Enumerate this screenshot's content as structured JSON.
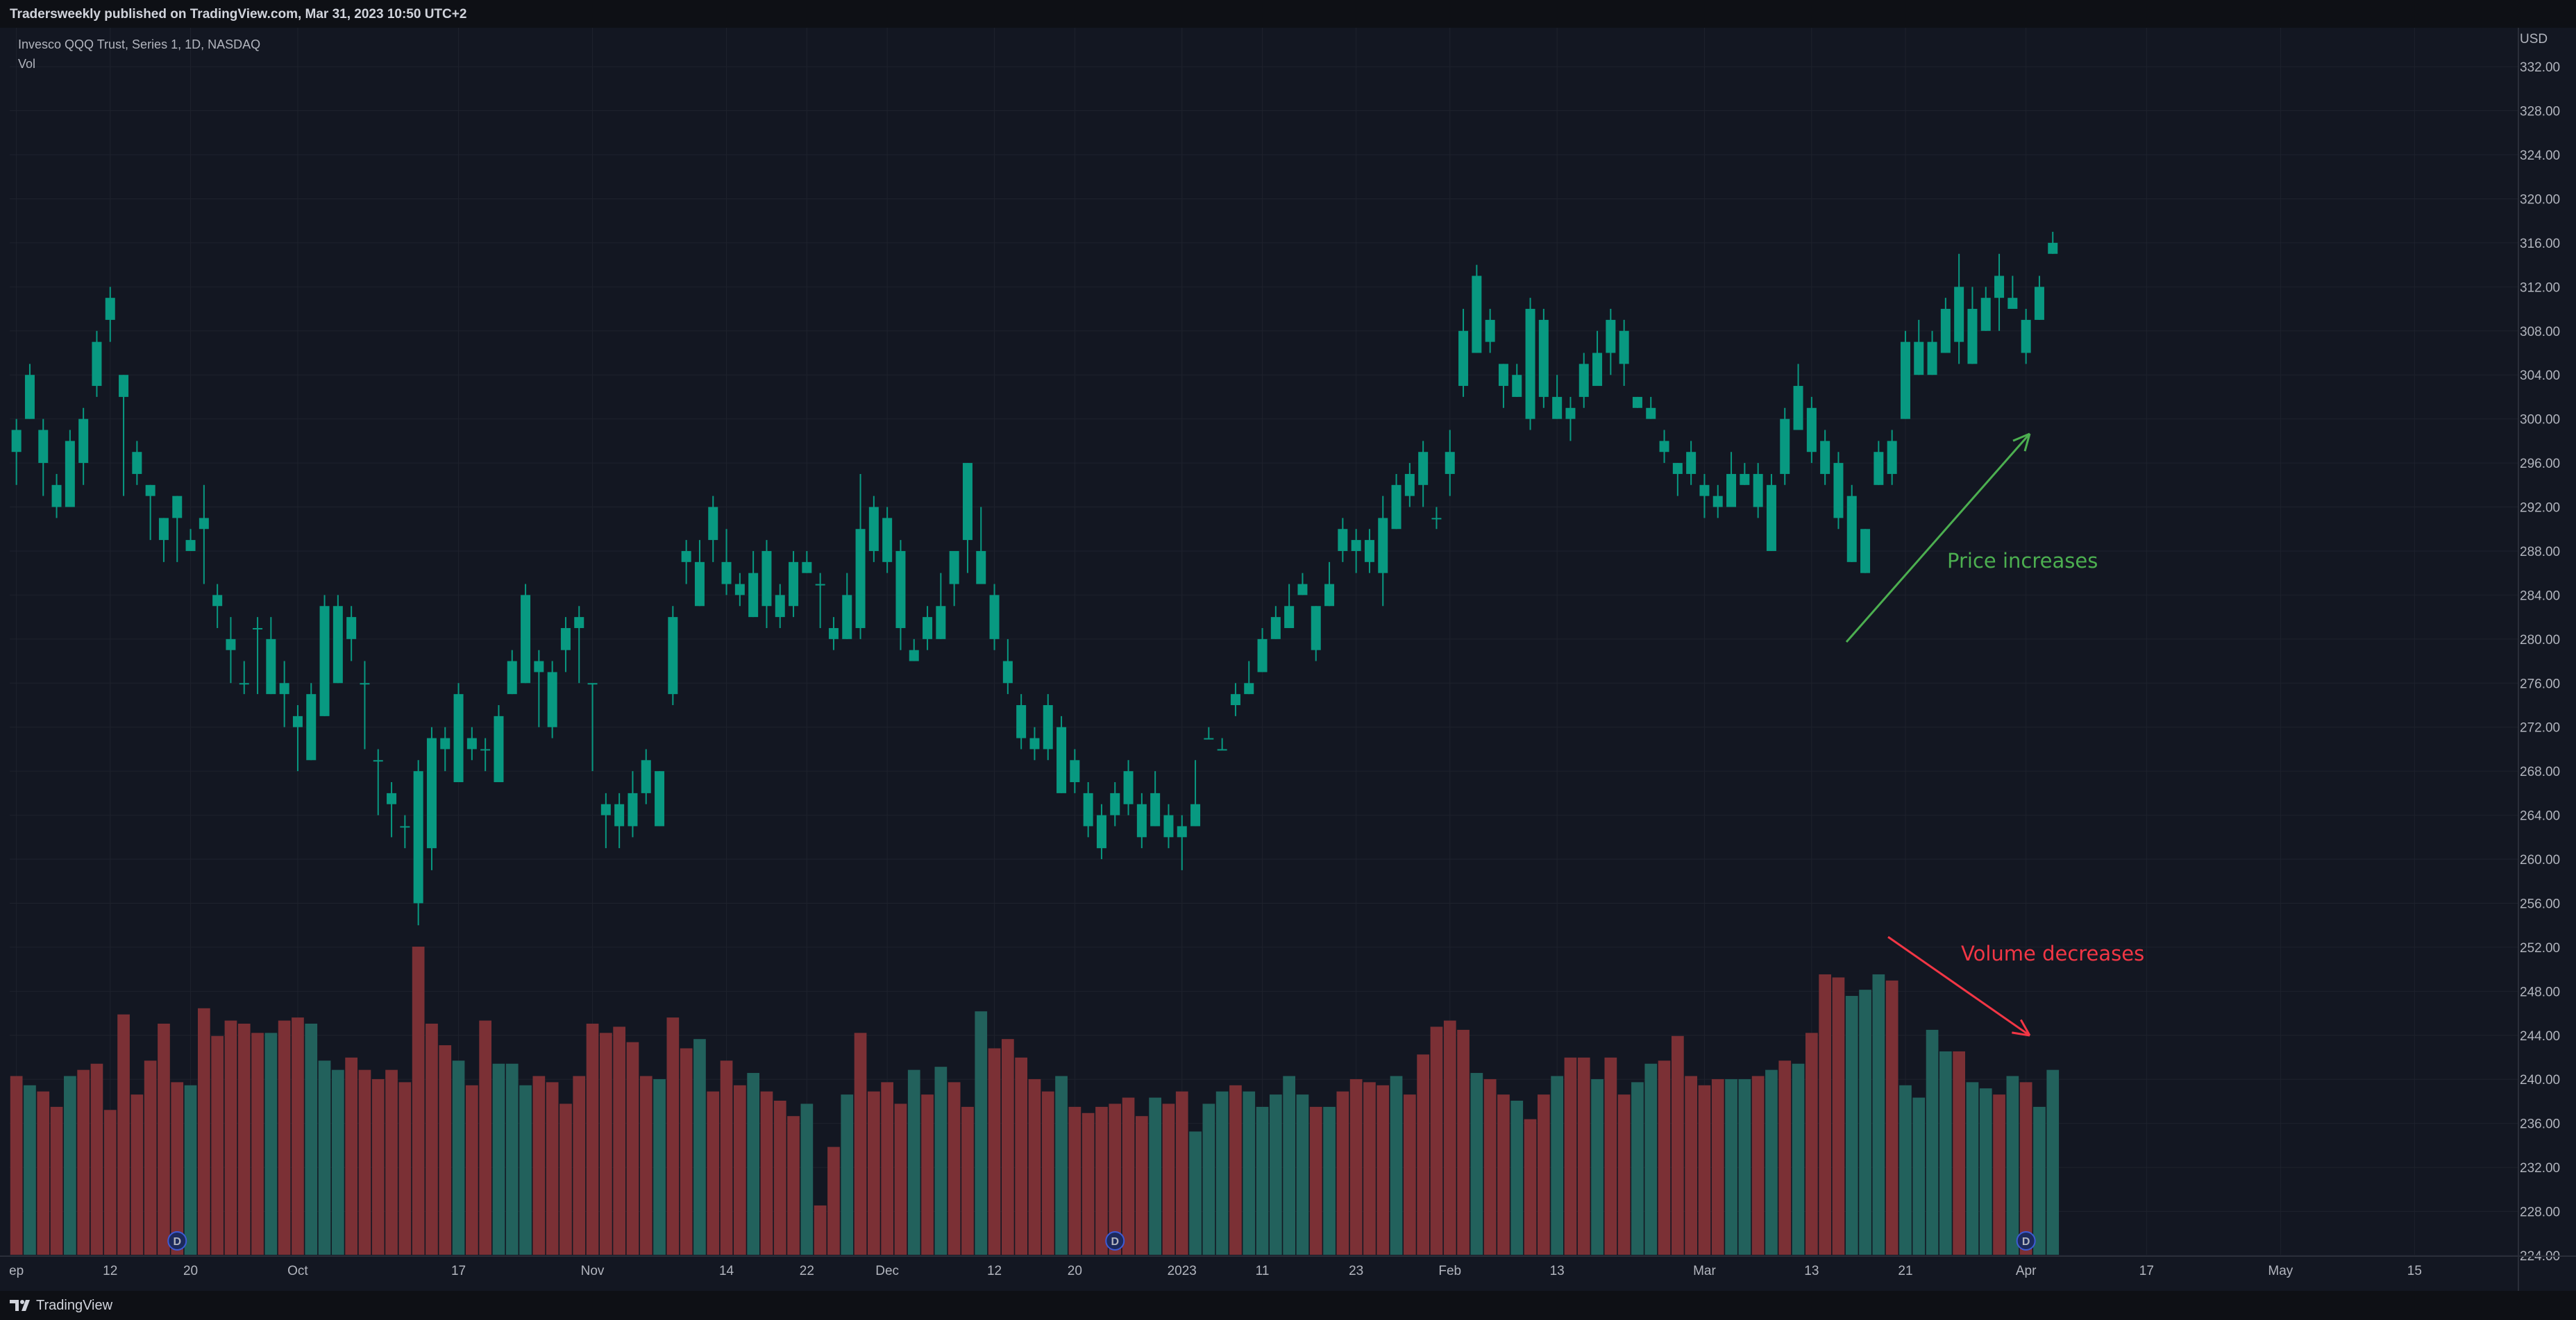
{
  "header": {
    "publisher": "Tradersweekly published on TradingView.com, Mar 31, 2023 10:50 UTC+2"
  },
  "legend": {
    "symbol": "Invesco QQQ Trust, Series 1, 1D, NASDAQ",
    "indicator": "Vol"
  },
  "footer": {
    "brand": "TradingView"
  },
  "colors": {
    "up": "#089981",
    "down": "#f23645",
    "vol_up": "#22615c",
    "vol_down": "#7b3035",
    "background": "#131722",
    "grid": "#1e222d"
  },
  "chart_data": {
    "type": "candlestick",
    "currency": "USD",
    "y_ticks": [
      "332.00",
      "328.00",
      "324.00",
      "320.00",
      "316.00",
      "312.00",
      "308.00",
      "304.00",
      "300.00",
      "296.00",
      "292.00",
      "288.00",
      "284.00",
      "280.00",
      "276.00",
      "272.00",
      "268.00",
      "264.00",
      "260.00",
      "256.00",
      "252.00",
      "248.00",
      "244.00",
      "240.00",
      "236.00",
      "232.00",
      "228.00",
      "224.00"
    ],
    "ylim": [
      224,
      334
    ],
    "x_ticks": [
      "ep",
      "12",
      "20",
      "Oct",
      "17",
      "Nov",
      "14",
      "22",
      "Dec",
      "12",
      "20",
      "2023",
      "11",
      "23",
      "Feb",
      "13",
      "Mar",
      "13",
      "21",
      "Apr",
      "17",
      "May",
      "15"
    ],
    "x_tick_bar_index": [
      0,
      7,
      13,
      21,
      33,
      43,
      53,
      59,
      65,
      73,
      79,
      87,
      93,
      100,
      107,
      115,
      126,
      134,
      141,
      150,
      159,
      169,
      179
    ],
    "candles": [
      [
        0,
        297,
        299,
        294,
        300
      ],
      [
        1,
        300,
        304,
        300,
        305
      ],
      [
        2,
        296,
        299,
        293,
        300
      ],
      [
        3,
        292,
        294,
        291,
        295
      ],
      [
        4,
        292,
        298,
        292,
        299
      ],
      [
        5,
        296,
        300,
        294,
        301
      ],
      [
        6,
        303,
        307,
        302,
        308
      ],
      [
        7,
        309,
        311,
        307,
        312
      ],
      [
        8,
        302,
        304,
        293,
        304
      ],
      [
        9,
        295,
        297,
        294,
        298
      ],
      [
        10,
        293,
        294,
        289,
        294
      ],
      [
        11,
        289,
        291,
        287,
        291
      ],
      [
        12,
        291,
        293,
        287,
        293
      ],
      [
        13,
        288,
        289,
        289,
        290
      ],
      [
        14,
        290,
        291,
        285,
        294
      ],
      [
        15,
        283,
        284,
        281,
        285
      ],
      [
        16,
        279,
        280,
        276,
        282
      ],
      [
        17,
        276,
        276,
        275,
        278
      ],
      [
        18,
        281,
        281,
        275,
        282
      ],
      [
        19,
        275,
        280,
        275,
        282
      ],
      [
        20,
        275,
        276,
        272,
        278
      ],
      [
        21,
        272,
        273,
        268,
        274
      ],
      [
        22,
        269,
        275,
        269,
        276
      ],
      [
        23,
        273,
        283,
        278,
        284
      ],
      [
        24,
        276,
        283,
        280,
        284
      ],
      [
        25,
        280,
        282,
        278,
        283
      ],
      [
        26,
        276,
        276,
        270,
        278
      ],
      [
        27,
        269,
        269,
        264,
        270
      ],
      [
        28,
        265,
        266,
        262,
        267
      ],
      [
        29,
        263,
        263,
        261,
        264
      ],
      [
        30,
        256,
        268,
        254,
        269
      ],
      [
        31,
        261,
        271,
        259,
        272
      ],
      [
        32,
        270,
        271,
        268,
        272
      ],
      [
        33,
        267,
        275,
        267,
        276
      ],
      [
        34,
        270,
        271,
        269,
        272
      ],
      [
        35,
        270,
        270,
        268,
        271
      ],
      [
        36,
        267,
        273,
        267,
        274
      ],
      [
        37,
        275,
        278,
        275,
        279
      ],
      [
        38,
        276,
        284,
        276,
        285
      ],
      [
        39,
        277,
        278,
        272,
        279
      ],
      [
        40,
        272,
        277,
        271,
        278
      ],
      [
        41,
        279,
        281,
        277,
        282
      ],
      [
        42,
        281,
        282,
        276,
        283
      ],
      [
        43,
        276,
        276,
        268,
        276
      ],
      [
        44,
        264,
        265,
        261,
        266
      ],
      [
        45,
        263,
        265,
        261,
        266
      ],
      [
        46,
        263,
        266,
        262,
        268
      ],
      [
        47,
        266,
        269,
        265,
        270
      ],
      [
        48,
        263,
        268,
        263,
        268
      ],
      [
        49,
        275,
        282,
        274,
        283
      ],
      [
        50,
        287,
        288,
        285,
        289
      ],
      [
        51,
        283,
        287,
        283,
        289
      ],
      [
        52,
        289,
        292,
        287,
        293
      ],
      [
        53,
        285,
        287,
        284,
        290
      ],
      [
        54,
        284,
        285,
        283,
        286
      ],
      [
        55,
        282,
        286,
        282,
        288
      ],
      [
        56,
        283,
        288,
        281,
        289
      ],
      [
        57,
        282,
        284,
        281,
        285
      ],
      [
        58,
        283,
        287,
        282,
        288
      ],
      [
        59,
        286,
        287,
        287,
        288
      ],
      [
        60,
        285,
        285,
        281,
        286
      ],
      [
        61,
        280,
        281,
        279,
        282
      ],
      [
        62,
        280,
        284,
        280,
        286
      ],
      [
        63,
        281,
        290,
        280,
        295
      ],
      [
        64,
        288,
        292,
        287,
        293
      ],
      [
        65,
        287,
        291,
        286,
        292
      ],
      [
        66,
        281,
        288,
        279,
        289
      ],
      [
        67,
        278,
        279,
        279,
        280
      ],
      [
        68,
        280,
        282,
        279,
        283
      ],
      [
        69,
        280,
        283,
        281,
        286
      ],
      [
        70,
        285,
        288,
        283,
        288
      ],
      [
        71,
        289,
        296,
        286,
        296
      ],
      [
        72,
        285,
        288,
        286,
        292
      ],
      [
        73,
        280,
        284,
        279,
        285
      ],
      [
        74,
        276,
        278,
        275,
        280
      ],
      [
        75,
        271,
        274,
        270,
        275
      ],
      [
        76,
        270,
        271,
        269,
        272
      ],
      [
        77,
        270,
        274,
        269,
        275
      ],
      [
        78,
        266,
        272,
        266,
        273
      ],
      [
        79,
        267,
        269,
        266,
        270
      ],
      [
        80,
        263,
        266,
        262,
        267
      ],
      [
        81,
        261,
        264,
        260,
        265
      ],
      [
        82,
        264,
        266,
        263,
        267
      ],
      [
        83,
        265,
        268,
        264,
        269
      ],
      [
        84,
        262,
        265,
        261,
        266
      ],
      [
        85,
        263,
        266,
        263,
        268
      ],
      [
        86,
        262,
        264,
        261,
        265
      ],
      [
        87,
        262,
        263,
        259,
        264
      ],
      [
        88,
        263,
        265,
        264,
        269
      ],
      [
        89,
        271,
        271,
        271,
        272
      ],
      [
        90,
        270,
        270,
        270,
        271
      ],
      [
        91,
        274,
        275,
        273,
        276
      ],
      [
        92,
        275,
        276,
        275,
        278
      ],
      [
        93,
        277,
        280,
        277,
        281
      ],
      [
        94,
        280,
        282,
        280,
        283
      ],
      [
        95,
        281,
        283,
        282,
        285
      ],
      [
        96,
        284,
        285,
        284,
        286
      ],
      [
        97,
        279,
        283,
        278,
        283
      ],
      [
        98,
        283,
        285,
        285,
        287
      ],
      [
        99,
        288,
        290,
        287,
        291
      ],
      [
        100,
        288,
        289,
        286,
        290
      ],
      [
        101,
        287,
        289,
        286,
        290
      ],
      [
        102,
        286,
        291,
        283,
        293
      ],
      [
        103,
        290,
        294,
        290,
        295
      ],
      [
        104,
        293,
        295,
        292,
        296
      ],
      [
        105,
        294,
        297,
        292,
        298
      ],
      [
        106,
        291,
        291,
        290,
        292
      ],
      [
        107,
        295,
        297,
        293,
        299
      ],
      [
        108,
        303,
        308,
        302,
        310
      ],
      [
        109,
        306,
        313,
        309,
        314
      ],
      [
        110,
        307,
        309,
        306,
        310
      ],
      [
        111,
        303,
        305,
        301,
        305
      ],
      [
        112,
        302,
        304,
        303,
        305
      ],
      [
        113,
        300,
        310,
        299,
        311
      ],
      [
        114,
        302,
        309,
        301,
        310
      ],
      [
        115,
        300,
        302,
        300,
        304
      ],
      [
        116,
        300,
        301,
        298,
        302
      ],
      [
        117,
        302,
        305,
        301,
        306
      ],
      [
        118,
        303,
        306,
        303,
        308
      ],
      [
        119,
        306,
        309,
        304,
        310
      ],
      [
        120,
        305,
        308,
        303,
        309
      ],
      [
        121,
        301,
        302,
        301,
        302
      ],
      [
        122,
        300,
        301,
        300,
        302
      ],
      [
        123,
        297,
        298,
        296,
        299
      ],
      [
        124,
        295,
        296,
        293,
        296
      ],
      [
        125,
        295,
        297,
        294,
        298
      ],
      [
        126,
        293,
        294,
        291,
        295
      ],
      [
        127,
        292,
        293,
        291,
        294
      ],
      [
        128,
        292,
        295,
        292,
        297
      ],
      [
        129,
        294,
        295,
        294,
        296
      ],
      [
        130,
        292,
        295,
        291,
        296
      ],
      [
        131,
        288,
        294,
        288,
        295
      ],
      [
        132,
        295,
        300,
        294,
        301
      ],
      [
        133,
        299,
        303,
        299,
        305
      ],
      [
        134,
        297,
        301,
        296,
        302
      ],
      [
        135,
        295,
        298,
        294,
        299
      ],
      [
        136,
        291,
        296,
        290,
        297
      ],
      [
        137,
        287,
        293,
        287,
        294
      ],
      [
        138,
        286,
        290,
        286,
        290
      ],
      [
        139,
        294,
        297,
        294,
        298
      ],
      [
        140,
        295,
        298,
        294,
        299
      ],
      [
        141,
        300,
        307,
        300,
        308
      ],
      [
        142,
        304,
        307,
        304,
        309
      ],
      [
        143,
        304,
        307,
        304,
        308
      ],
      [
        144,
        306,
        310,
        307,
        311
      ],
      [
        145,
        307,
        312,
        305,
        315
      ],
      [
        146,
        305,
        310,
        306,
        312
      ],
      [
        147,
        308,
        311,
        309,
        312
      ],
      [
        148,
        311,
        313,
        308,
        315
      ],
      [
        149,
        310,
        311,
        310,
        313
      ],
      [
        150,
        306,
        309,
        305,
        310
      ],
      [
        151,
        309,
        312,
        309,
        313
      ],
      [
        152,
        315,
        316,
        315,
        317
      ]
    ],
    "volume_rel": [
      0.58,
      0.55,
      0.53,
      0.48,
      0.58,
      0.6,
      0.62,
      0.47,
      0.78,
      0.52,
      0.63,
      0.75,
      0.56,
      0.55,
      0.8,
      0.71,
      0.76,
      0.75,
      0.72,
      0.72,
      0.76,
      0.77,
      0.75,
      0.63,
      0.6,
      0.64,
      0.6,
      0.57,
      0.6,
      0.56,
      1.0,
      0.75,
      0.68,
      0.63,
      0.55,
      0.76,
      0.62,
      0.62,
      0.55,
      0.58,
      0.56,
      0.49,
      0.58,
      0.75,
      0.72,
      0.74,
      0.69,
      0.58,
      0.57,
      0.77,
      0.67,
      0.7,
      0.53,
      0.63,
      0.55,
      0.59,
      0.53,
      0.5,
      0.45,
      0.49,
      0.16,
      0.35,
      0.52,
      0.72,
      0.53,
      0.56,
      0.49,
      0.6,
      0.52,
      0.61,
      0.56,
      0.48,
      0.79,
      0.67,
      0.7,
      0.64,
      0.57,
      0.53,
      0.58,
      0.48,
      0.46,
      0.48,
      0.49,
      0.51,
      0.45,
      0.51,
      0.49,
      0.53,
      0.4,
      0.49,
      0.53,
      0.55,
      0.53,
      0.48,
      0.52,
      0.58,
      0.52,
      0.48,
      0.48,
      0.53,
      0.57,
      0.56,
      0.55,
      0.58,
      0.52,
      0.65,
      0.74,
      0.76,
      0.73,
      0.59,
      0.57,
      0.52,
      0.5,
      0.44,
      0.52,
      0.58,
      0.64,
      0.64,
      0.57,
      0.64,
      0.52,
      0.56,
      0.62,
      0.63,
      0.71,
      0.58,
      0.55,
      0.57,
      0.57,
      0.57,
      0.58,
      0.6,
      0.63,
      0.62,
      0.72,
      0.91,
      0.9,
      0.84,
      0.86,
      0.91,
      0.89,
      0.55,
      0.51,
      0.73,
      0.66,
      0.66,
      0.56,
      0.54,
      0.52,
      0.58,
      0.56,
      0.48,
      0.6
    ]
  },
  "dividends": {
    "label": "D",
    "bar_index": [
      12,
      82,
      150
    ]
  },
  "annotations": {
    "price": {
      "text": "Price increases"
    },
    "volume": {
      "text": "Volume decreases"
    }
  }
}
